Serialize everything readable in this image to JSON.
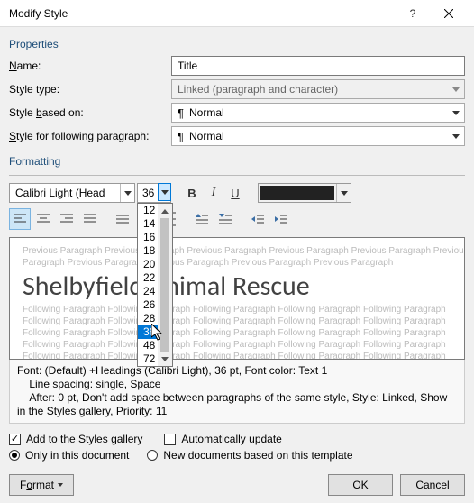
{
  "titlebar": {
    "title": "Modify Style"
  },
  "sections": {
    "properties": "Properties",
    "formatting": "Formatting"
  },
  "labels": {
    "name_pre": "",
    "name_u": "N",
    "name_post": "ame:",
    "styletype": "Style type:",
    "basedon_pre": "Style ",
    "basedon_u": "b",
    "basedon_post": "ased on:",
    "following_pre": "",
    "following_u": "S",
    "following_post": "tyle for following paragraph:"
  },
  "fields": {
    "name": "Title",
    "style_type": "Linked (paragraph and character)",
    "based_on": "Normal",
    "following": "Normal",
    "font_name": "Calibri Light (Head",
    "font_size": "36"
  },
  "size_options": [
    "12",
    "14",
    "16",
    "18",
    "20",
    "22",
    "24",
    "26",
    "28",
    "36",
    "48",
    "72"
  ],
  "size_selected": "36",
  "preview": {
    "grey_line": "Previous Paragraph Previous Paragraph Previous Paragraph Previous Paragraph Previous Paragraph Previous",
    "grey_line2": "Paragraph Previous Paragraph Previous Paragraph Previous Paragraph Previous Paragraph",
    "sample": "Shelbyfield Animal Rescue",
    "follow": "Following Paragraph Following Paragraph Following Paragraph Following Paragraph Following Paragraph"
  },
  "description": {
    "line1": "Font: (Default) +Headings (Calibri Light), 36 pt, Font color: Text 1",
    "line2": "    Line spacing:  single, Space",
    "line3": "    After:  0 pt, Don't add space between paragraphs of the same style, Style: Linked, Show in the Styles gallery, Priority: 11"
  },
  "checks": {
    "add_gallery_pre": "",
    "add_gallery_u": "A",
    "add_gallery_post": "dd to the Styles gallery",
    "auto_update_pre": "Automatically ",
    "auto_update_u": "u",
    "auto_update_post": "pdate",
    "only_doc": "Only in this document",
    "new_docs": "New documents based on this template"
  },
  "buttons": {
    "format_pre": "F",
    "format_u": "o",
    "format_post": "rmat",
    "ok": "OK",
    "cancel": "Cancel"
  }
}
